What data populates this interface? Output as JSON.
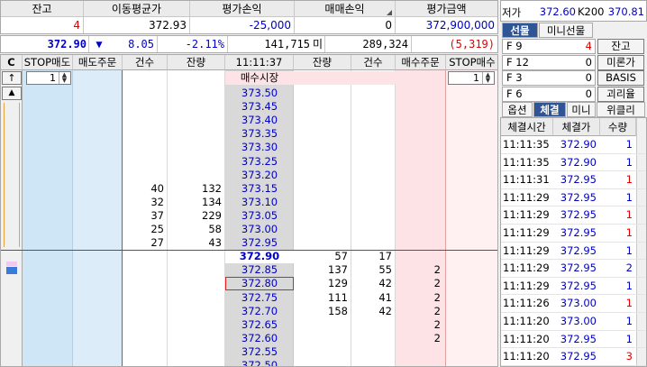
{
  "summary": {
    "headers": [
      "잔고",
      "이동평균가",
      "평가손익",
      "매매손익",
      "평가금액"
    ],
    "values": [
      "4",
      "372.93",
      "-25,000",
      "0",
      "372,900,000"
    ]
  },
  "pricebar": {
    "price": "372.90",
    "direction": "▼",
    "change": "8.05",
    "change_pct": "-2.11%",
    "volume": "141,715",
    "mi_label": "미",
    "open_interest": "289,324",
    "oi_change": "(5,319)"
  },
  "ladder": {
    "headers": {
      "c_btn": "C",
      "stop_sell": "STOP매도",
      "sell_order": "매도주문",
      "sell_count": "건수",
      "sell_qty": "잔량",
      "time": "11:11:37",
      "buy_qty": "잔량",
      "buy_count": "건수",
      "buy_order": "매수주문",
      "stop_buy": "STOP매수"
    },
    "up_btn": "↑",
    "top_arrow": "▲",
    "stop_sell_qty": "1",
    "stop_buy_qty": "1",
    "market_buy": "매수시장",
    "rows": [
      {
        "price": "373.50"
      },
      {
        "price": "373.45"
      },
      {
        "price": "373.40"
      },
      {
        "price": "373.35"
      },
      {
        "price": "373.30"
      },
      {
        "price": "373.25"
      },
      {
        "price": "373.20"
      },
      {
        "price": "373.15",
        "sc": "40",
        "sq": "132"
      },
      {
        "price": "373.10",
        "sc": "32",
        "sq": "134"
      },
      {
        "price": "373.05",
        "sc": "37",
        "sq": "229"
      },
      {
        "price": "373.00",
        "sc": "25",
        "sq": "58"
      },
      {
        "price": "372.95",
        "sc": "27",
        "sq": "43"
      },
      {
        "price": "372.90",
        "bq": "57",
        "bc": "17",
        "current": true
      },
      {
        "price": "372.85",
        "bq": "137",
        "bc": "55",
        "bo": "2"
      },
      {
        "price": "372.80",
        "bq": "129",
        "bc": "42",
        "bo": "2",
        "selected": true
      },
      {
        "price": "372.75",
        "bq": "111",
        "bc": "41",
        "bo": "2"
      },
      {
        "price": "372.70",
        "bq": "158",
        "bc": "42",
        "bo": "2"
      },
      {
        "price": "372.65",
        "bo": "2"
      },
      {
        "price": "372.60",
        "bo": "2"
      },
      {
        "price": "372.55"
      },
      {
        "price": "372.50"
      }
    ]
  },
  "right": {
    "top_rows": [
      {
        "label": "저가",
        "value": "372.60",
        "label2": "K200",
        "value2": "370.81"
      }
    ],
    "tabs1": [
      "선물",
      "미니선물"
    ],
    "fkeys": [
      {
        "key": "F 9",
        "val": "4",
        "btn": "잔고"
      },
      {
        "key": "F 12",
        "val": "0",
        "btn": "미론가"
      },
      {
        "key": "F 3",
        "val": "0",
        "btn": "BASIS"
      },
      {
        "key": "F 6",
        "val": "0",
        "btn": "괴리율"
      }
    ],
    "tabs2": [
      "옵션",
      "체결",
      "미니",
      "위클리"
    ],
    "trade_headers": [
      "체결시간",
      "체결가",
      "수량"
    ],
    "trades": [
      {
        "t": "11:11:35",
        "p": "372.90",
        "q": "1",
        "c": "blue"
      },
      {
        "t": "11:11:35",
        "p": "372.90",
        "q": "1",
        "c": "blue"
      },
      {
        "t": "11:11:31",
        "p": "372.95",
        "q": "1",
        "c": "red"
      },
      {
        "t": "11:11:29",
        "p": "372.95",
        "q": "1",
        "c": "blue"
      },
      {
        "t": "11:11:29",
        "p": "372.95",
        "q": "1",
        "c": "red"
      },
      {
        "t": "11:11:29",
        "p": "372.95",
        "q": "1",
        "c": "red"
      },
      {
        "t": "11:11:29",
        "p": "372.95",
        "q": "1",
        "c": "blue"
      },
      {
        "t": "11:11:29",
        "p": "372.95",
        "q": "2",
        "c": "blue"
      },
      {
        "t": "11:11:29",
        "p": "372.95",
        "q": "1",
        "c": "blue"
      },
      {
        "t": "11:11:26",
        "p": "373.00",
        "q": "1",
        "c": "red"
      },
      {
        "t": "11:11:20",
        "p": "373.00",
        "q": "1",
        "c": "blue"
      },
      {
        "t": "11:11:20",
        "p": "372.95",
        "q": "1",
        "c": "blue"
      },
      {
        "t": "11:11:20",
        "p": "372.95",
        "q": "3",
        "c": "red"
      },
      {
        "t": "11:11:19",
        "p": "372.95",
        "q": "1",
        "c": "blue"
      }
    ]
  }
}
